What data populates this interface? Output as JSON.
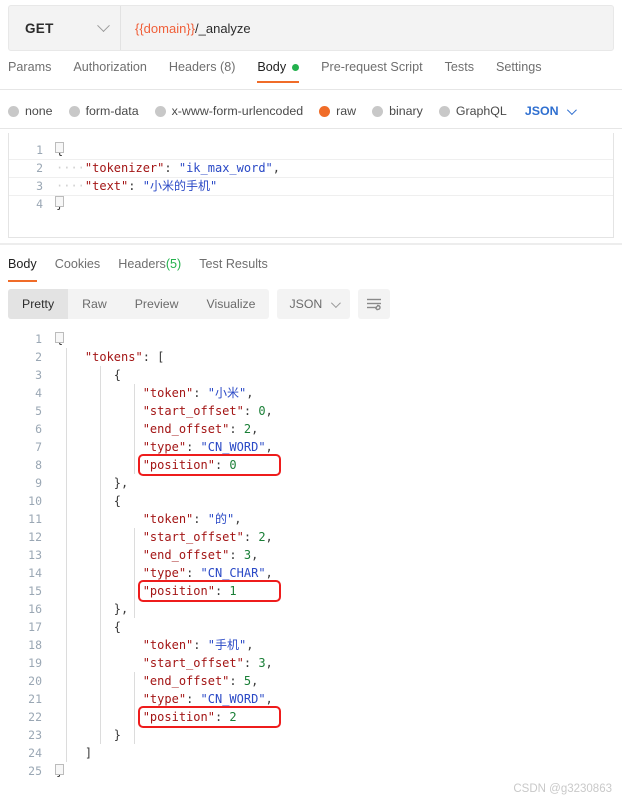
{
  "request": {
    "method": "GET",
    "method_caret": "chevron-down",
    "url_variable": "{{domain}}",
    "url_path": "/_analyze",
    "url_full": "{{domain}}/_analyze",
    "tabs": [
      {
        "label": "Params",
        "active": false
      },
      {
        "label": "Authorization",
        "active": false
      },
      {
        "label": "Headers (8)",
        "active": false
      },
      {
        "label": "Body",
        "active": true,
        "dot": true
      },
      {
        "label": "Pre-request Script",
        "active": false
      },
      {
        "label": "Tests",
        "active": false
      },
      {
        "label": "Settings",
        "active": false
      }
    ],
    "body_types": [
      {
        "label": "none",
        "selected": false
      },
      {
        "label": "form-data",
        "selected": false
      },
      {
        "label": "x-www-form-urlencoded",
        "selected": false
      },
      {
        "label": "raw",
        "selected": true
      },
      {
        "label": "binary",
        "selected": false
      },
      {
        "label": "GraphQL",
        "selected": false
      }
    ],
    "format_label": "JSON",
    "body_lines": [
      {
        "num": "1",
        "segs": [
          {
            "t": "{",
            "c": "p"
          }
        ]
      },
      {
        "num": "2",
        "segs": [
          {
            "t": "····",
            "c": "ws"
          },
          {
            "t": "\"tokenizer\"",
            "c": "k"
          },
          {
            "t": ": ",
            "c": "p"
          },
          {
            "t": "\"ik_max_word\"",
            "c": "s"
          },
          {
            "t": ",",
            "c": "p"
          }
        ]
      },
      {
        "num": "3",
        "segs": [
          {
            "t": "····",
            "c": "ws"
          },
          {
            "t": "\"text\"",
            "c": "k"
          },
          {
            "t": ": ",
            "c": "p"
          },
          {
            "t": "\"小米的手机\"",
            "c": "s"
          }
        ]
      },
      {
        "num": "4",
        "segs": [
          {
            "t": "}",
            "c": "p"
          }
        ]
      }
    ]
  },
  "response": {
    "tabs": [
      {
        "label": "Body",
        "active": true
      },
      {
        "label": "Cookies",
        "active": false
      },
      {
        "label": "Headers",
        "count": "(5)",
        "active": false
      },
      {
        "label": "Test Results",
        "active": false
      }
    ],
    "view_modes": [
      {
        "label": "Pretty",
        "active": true
      },
      {
        "label": "Raw",
        "active": false
      },
      {
        "label": "Preview",
        "active": false
      },
      {
        "label": "Visualize",
        "active": false
      }
    ],
    "format_label": "JSON",
    "wrap_icon": "wrap-lines-icon",
    "body_lines": [
      {
        "num": "1",
        "segs": [
          {
            "t": "{",
            "c": "p"
          }
        ]
      },
      {
        "num": "2",
        "segs": [
          {
            "t": "    ",
            "c": "p"
          },
          {
            "t": "\"tokens\"",
            "c": "k"
          },
          {
            "t": ": [",
            "c": "p"
          }
        ]
      },
      {
        "num": "3",
        "segs": [
          {
            "t": "        ",
            "c": "p"
          },
          {
            "t": "{",
            "c": "p"
          }
        ]
      },
      {
        "num": "4",
        "segs": [
          {
            "t": "            ",
            "c": "p"
          },
          {
            "t": "\"token\"",
            "c": "k"
          },
          {
            "t": ": ",
            "c": "p"
          },
          {
            "t": "\"小米\"",
            "c": "s"
          },
          {
            "t": ",",
            "c": "p"
          }
        ]
      },
      {
        "num": "5",
        "segs": [
          {
            "t": "            ",
            "c": "p"
          },
          {
            "t": "\"start_offset\"",
            "c": "k"
          },
          {
            "t": ": ",
            "c": "p"
          },
          {
            "t": "0",
            "c": "n"
          },
          {
            "t": ",",
            "c": "p"
          }
        ]
      },
      {
        "num": "6",
        "segs": [
          {
            "t": "            ",
            "c": "p"
          },
          {
            "t": "\"end_offset\"",
            "c": "k"
          },
          {
            "t": ": ",
            "c": "p"
          },
          {
            "t": "2",
            "c": "n"
          },
          {
            "t": ",",
            "c": "p"
          }
        ]
      },
      {
        "num": "7",
        "segs": [
          {
            "t": "            ",
            "c": "p"
          },
          {
            "t": "\"type\"",
            "c": "k"
          },
          {
            "t": ": ",
            "c": "p"
          },
          {
            "t": "\"CN_WORD\"",
            "c": "s"
          },
          {
            "t": ",",
            "c": "p"
          }
        ]
      },
      {
        "num": "8",
        "segs": [
          {
            "t": "            ",
            "c": "p"
          },
          {
            "t": "\"position\"",
            "c": "k"
          },
          {
            "t": ": ",
            "c": "p"
          },
          {
            "t": "0",
            "c": "n"
          }
        ]
      },
      {
        "num": "9",
        "segs": [
          {
            "t": "        ",
            "c": "p"
          },
          {
            "t": "},",
            "c": "p"
          }
        ]
      },
      {
        "num": "10",
        "segs": [
          {
            "t": "        ",
            "c": "p"
          },
          {
            "t": "{",
            "c": "p"
          }
        ]
      },
      {
        "num": "11",
        "segs": [
          {
            "t": "            ",
            "c": "p"
          },
          {
            "t": "\"token\"",
            "c": "k"
          },
          {
            "t": ": ",
            "c": "p"
          },
          {
            "t": "\"的\"",
            "c": "s"
          },
          {
            "t": ",",
            "c": "p"
          }
        ]
      },
      {
        "num": "12",
        "segs": [
          {
            "t": "            ",
            "c": "p"
          },
          {
            "t": "\"start_offset\"",
            "c": "k"
          },
          {
            "t": ": ",
            "c": "p"
          },
          {
            "t": "2",
            "c": "n"
          },
          {
            "t": ",",
            "c": "p"
          }
        ]
      },
      {
        "num": "13",
        "segs": [
          {
            "t": "            ",
            "c": "p"
          },
          {
            "t": "\"end_offset\"",
            "c": "k"
          },
          {
            "t": ": ",
            "c": "p"
          },
          {
            "t": "3",
            "c": "n"
          },
          {
            "t": ",",
            "c": "p"
          }
        ]
      },
      {
        "num": "14",
        "segs": [
          {
            "t": "            ",
            "c": "p"
          },
          {
            "t": "\"type\"",
            "c": "k"
          },
          {
            "t": ": ",
            "c": "p"
          },
          {
            "t": "\"CN_CHAR\"",
            "c": "s"
          },
          {
            "t": ",",
            "c": "p"
          }
        ]
      },
      {
        "num": "15",
        "segs": [
          {
            "t": "            ",
            "c": "p"
          },
          {
            "t": "\"position\"",
            "c": "k"
          },
          {
            "t": ": ",
            "c": "p"
          },
          {
            "t": "1",
            "c": "n"
          }
        ]
      },
      {
        "num": "16",
        "segs": [
          {
            "t": "        ",
            "c": "p"
          },
          {
            "t": "},",
            "c": "p"
          }
        ]
      },
      {
        "num": "17",
        "segs": [
          {
            "t": "        ",
            "c": "p"
          },
          {
            "t": "{",
            "c": "p"
          }
        ]
      },
      {
        "num": "18",
        "segs": [
          {
            "t": "            ",
            "c": "p"
          },
          {
            "t": "\"token\"",
            "c": "k"
          },
          {
            "t": ": ",
            "c": "p"
          },
          {
            "t": "\"手机\"",
            "c": "s"
          },
          {
            "t": ",",
            "c": "p"
          }
        ]
      },
      {
        "num": "19",
        "segs": [
          {
            "t": "            ",
            "c": "p"
          },
          {
            "t": "\"start_offset\"",
            "c": "k"
          },
          {
            "t": ": ",
            "c": "p"
          },
          {
            "t": "3",
            "c": "n"
          },
          {
            "t": ",",
            "c": "p"
          }
        ]
      },
      {
        "num": "20",
        "segs": [
          {
            "t": "            ",
            "c": "p"
          },
          {
            "t": "\"end_offset\"",
            "c": "k"
          },
          {
            "t": ": ",
            "c": "p"
          },
          {
            "t": "5",
            "c": "n"
          },
          {
            "t": ",",
            "c": "p"
          }
        ]
      },
      {
        "num": "21",
        "segs": [
          {
            "t": "            ",
            "c": "p"
          },
          {
            "t": "\"type\"",
            "c": "k"
          },
          {
            "t": ": ",
            "c": "p"
          },
          {
            "t": "\"CN_WORD\"",
            "c": "s"
          },
          {
            "t": ",",
            "c": "p"
          }
        ]
      },
      {
        "num": "22",
        "segs": [
          {
            "t": "            ",
            "c": "p"
          },
          {
            "t": "\"position\"",
            "c": "k"
          },
          {
            "t": ": ",
            "c": "p"
          },
          {
            "t": "2",
            "c": "n"
          }
        ]
      },
      {
        "num": "23",
        "segs": [
          {
            "t": "        ",
            "c": "p"
          },
          {
            "t": "}",
            "c": "p"
          }
        ]
      },
      {
        "num": "24",
        "segs": [
          {
            "t": "    ",
            "c": "p"
          },
          {
            "t": "]",
            "c": "p"
          }
        ]
      },
      {
        "num": "25",
        "segs": [
          {
            "t": "}",
            "c": "p"
          }
        ]
      }
    ],
    "highlights": [
      {
        "label": "position-0-highlight",
        "line": 8
      },
      {
        "label": "position-1-highlight",
        "line": 15
      },
      {
        "label": "position-2-highlight",
        "line": 22
      }
    ]
  },
  "watermark": "CSDN @g3230863",
  "colors": {
    "accent_orange": "#f06c28",
    "variable_orange": "#f0603a",
    "green": "#23b14d",
    "blue": "#2f6fd0",
    "highlight_red": "#ee1c1c"
  }
}
